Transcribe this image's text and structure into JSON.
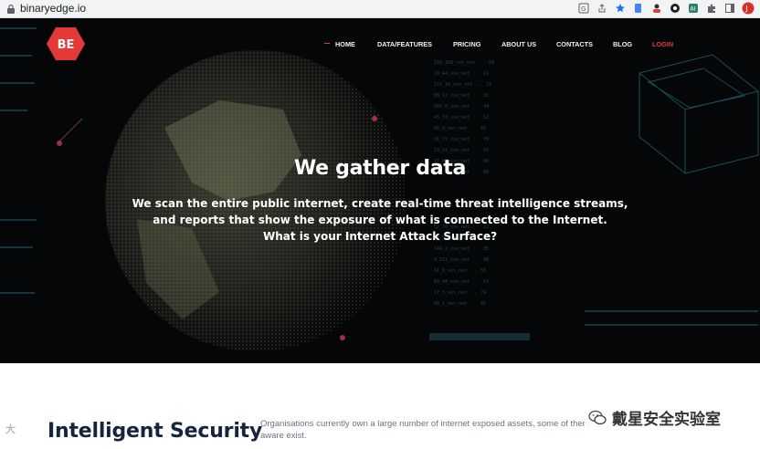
{
  "browser": {
    "url": "binaryedge.io",
    "toolbar_icons": [
      "translate-icon",
      "share-icon",
      "star-icon",
      "extension-icon",
      "profile-icon",
      "extension-2-icon",
      "extension-3-icon",
      "puzzle-icon",
      "sidebar-icon",
      "avatar-icon"
    ]
  },
  "site": {
    "logo_text": "BE",
    "nav": [
      {
        "label": "HOME",
        "active": true
      },
      {
        "label": "DATA/FEATURES"
      },
      {
        "label": "PRICING"
      },
      {
        "label": "ABOUT US"
      },
      {
        "label": "CONTACTS"
      },
      {
        "label": "BLOG"
      },
      {
        "label": "LOGIN",
        "accent": true
      }
    ]
  },
  "hero": {
    "title": "We gather data",
    "lines": [
      "We scan the entire public internet, create real-time threat intelligence streams,",
      "and reports that show the exposure of what is connected to the Internet.",
      "What is your Internet Attack Surface?"
    ]
  },
  "section": {
    "title": "Intelligent Security",
    "text": "Organisations currently own a large number of internet exposed assets, some of them",
    "text_2": "aware exist."
  },
  "watermark": {
    "text": "戴星安全实验室",
    "corner": "大"
  },
  "colors": {
    "accent": "#e53935",
    "hero_bg": "#050607",
    "title_dark": "#15253f"
  }
}
